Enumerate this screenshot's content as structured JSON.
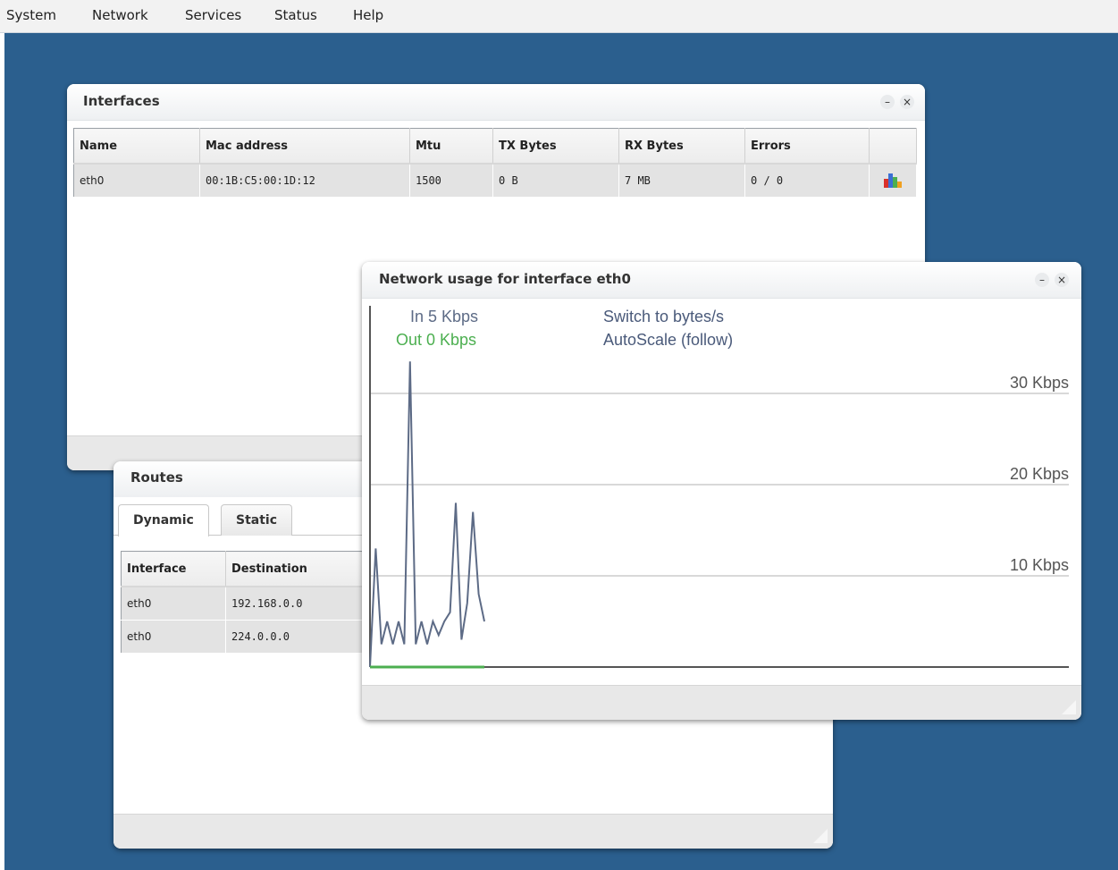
{
  "menu": [
    "System",
    "Network",
    "Services",
    "Status",
    "Help"
  ],
  "interfaces_window": {
    "title": "Interfaces",
    "minimize": "–",
    "close": "×",
    "columns": [
      "Name",
      "Mac address",
      "Mtu",
      "TX Bytes",
      "RX Bytes",
      "Errors"
    ],
    "rows": [
      {
        "name": "eth0",
        "mac": "00:1B:C5:00:1D:12",
        "mtu": "1500",
        "tx": "0 B",
        "rx": "7 MB",
        "errors": "0 / 0",
        "action_icon": "bar-chart-icon"
      }
    ]
  },
  "routes_window": {
    "title": "Routes",
    "tabs": [
      "Dynamic",
      "Static"
    ],
    "active_tab": "Dynamic",
    "columns": [
      "Interface",
      "Destination"
    ],
    "rows": [
      {
        "interface": "eth0",
        "destination": "192.168.0.0"
      },
      {
        "interface": "eth0",
        "destination": "224.0.0.0"
      }
    ]
  },
  "usage_window": {
    "title": "Network usage for interface eth0",
    "minimize": "–",
    "close": "×",
    "legend_in": "In 5 Kbps",
    "legend_out": "Out 0 Kbps",
    "switch_link": "Switch to bytes/s",
    "autoscale_link": "AutoScale (follow)",
    "colors": {
      "in": "#5d6b86",
      "out": "#4caf50",
      "grid": "#d9d9d9"
    }
  },
  "chart_data": {
    "type": "line",
    "ylabel_ticks": [
      "10 Kbps",
      "20 Kbps",
      "30 Kbps"
    ],
    "y_ticks": [
      10,
      20,
      30
    ],
    "series": [
      {
        "name": "In",
        "values": [
          0,
          13,
          2.5,
          5,
          2.5,
          5,
          2.5,
          33.5,
          2.5,
          5,
          2.5,
          5,
          3.5,
          5,
          6,
          18,
          3,
          7,
          17,
          8,
          5
        ]
      },
      {
        "name": "Out",
        "values": [
          0,
          0,
          0,
          0,
          0,
          0,
          0,
          0,
          0,
          0,
          0,
          0,
          0,
          0,
          0,
          0,
          0,
          0,
          0,
          0,
          0
        ]
      }
    ]
  }
}
